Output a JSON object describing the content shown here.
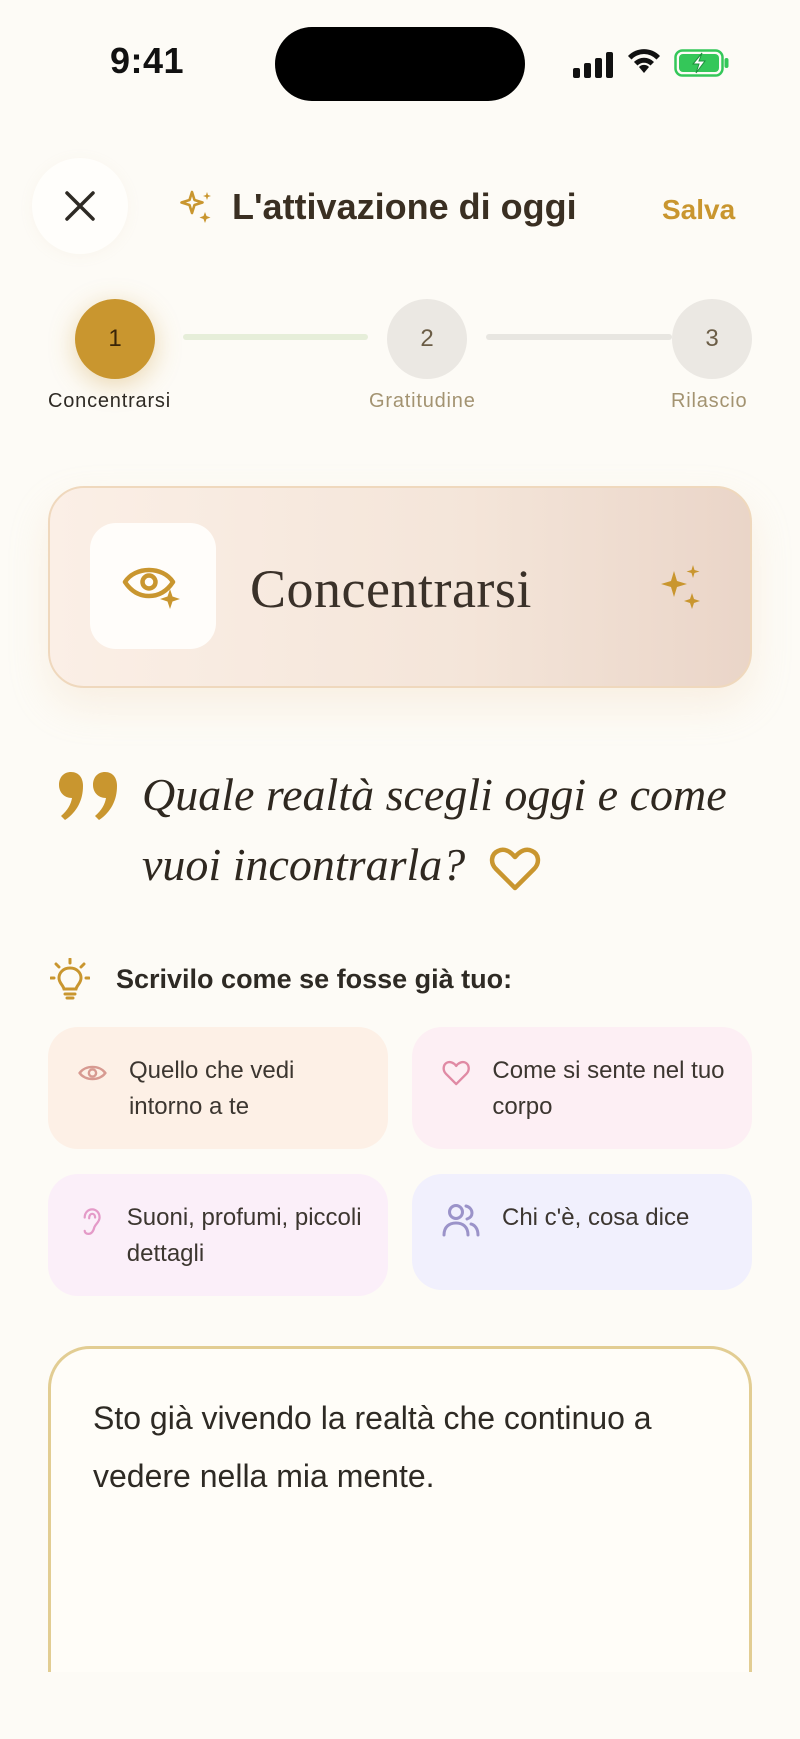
{
  "status_bar": {
    "time": "9:41"
  },
  "header": {
    "title": "L'attivazione di oggi",
    "save_label": "Salva"
  },
  "stepper": {
    "current_step": 1,
    "steps": [
      {
        "number": "1",
        "label": "Concentrarsi"
      },
      {
        "number": "2",
        "label": "Gratitudine"
      },
      {
        "number": "3",
        "label": "Rilascio"
      }
    ]
  },
  "focus_card": {
    "title": "Concentrarsi"
  },
  "prompt": {
    "question": "Quale realtà scegli oggi e come vuoi incontrarla?"
  },
  "tip": {
    "label": "Scrivilo come se fosse già tuo:"
  },
  "hints": [
    {
      "icon": "eye-icon",
      "text": "Quello che vedi intorno a te"
    },
    {
      "icon": "heart-icon",
      "text": "Come si sente nel tuo corpo"
    },
    {
      "icon": "ear-icon",
      "text": "Suoni, profumi, piccoli dettagli"
    },
    {
      "icon": "people-icon",
      "text": "Chi c'è, cosa dice"
    }
  ],
  "journal": {
    "value": "Sto già vivendo la realtà che continuo a vedere nella mia mente."
  },
  "colors": {
    "accent": "#c9962f",
    "background": "#fdfbf6",
    "text": "#2e2a24"
  }
}
